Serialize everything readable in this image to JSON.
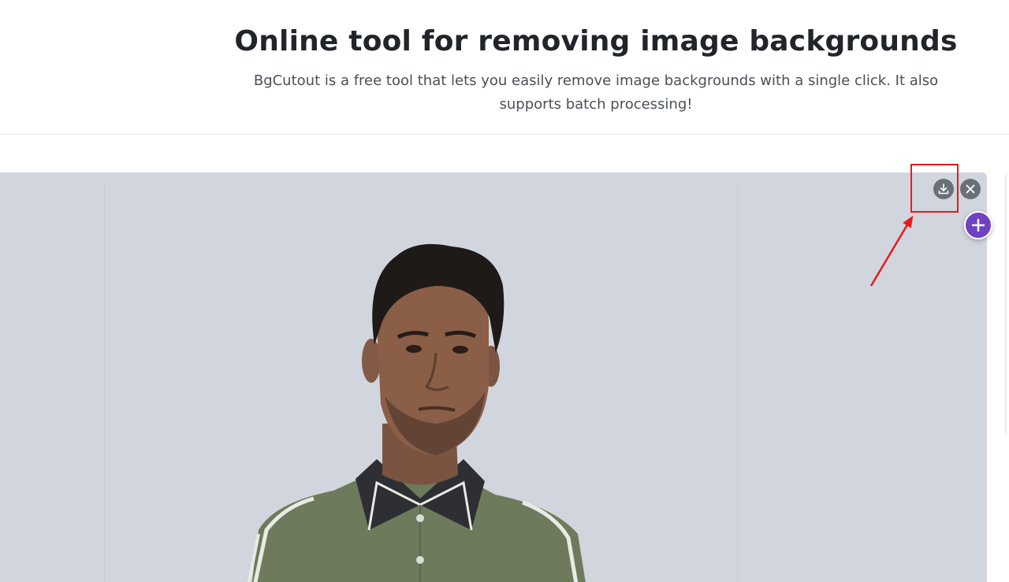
{
  "header": {
    "title": "Online tool for removing image backgrounds",
    "subtitle": "BgCutout is a free tool that lets you easily remove image backgrounds with a single click. It also supports batch processing!"
  },
  "preview": {
    "actions": [
      {
        "name": "download",
        "icon": "download-icon"
      },
      {
        "name": "close",
        "icon": "close-icon"
      }
    ],
    "add_icon": "plus-icon"
  },
  "colors": {
    "accent": "#6f42c1",
    "preview_background": "#d1d5dd",
    "highlight": "#e81a1a",
    "icon_button": "#6b7078"
  }
}
